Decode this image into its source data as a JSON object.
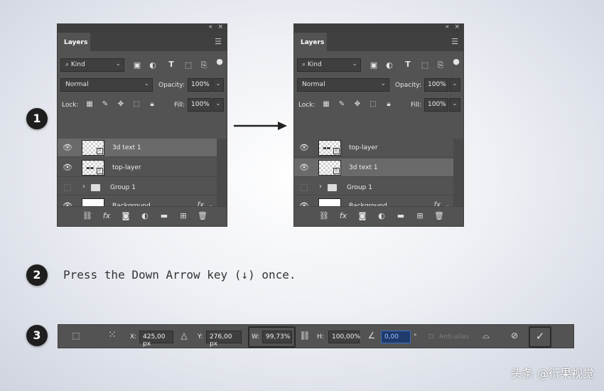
{
  "left_panel": {
    "tab": "Layers",
    "collapse_glyph": "«",
    "close_glyph": "×",
    "filter_kind": "Kind",
    "blend_mode": "Normal",
    "opacity_label": "Opacity:",
    "opacity_value": "100%",
    "lock_label": "Lock:",
    "fill_label": "Fill:",
    "fill_value": "100%",
    "layers": [
      {
        "name": "3d text 1",
        "type": "smart",
        "selected": true
      },
      {
        "name": "top-layer",
        "type": "smart",
        "selected": false
      },
      {
        "name": "Group 1",
        "type": "group",
        "selected": false
      },
      {
        "name": "Background",
        "type": "white",
        "selected": false
      }
    ],
    "fx_label": "fx"
  },
  "right_panel": {
    "tab": "Layers",
    "collapse_glyph": "«",
    "close_glyph": "×",
    "filter_kind": "Kind",
    "blend_mode": "Normal",
    "opacity_label": "Opacity:",
    "opacity_value": "100%",
    "lock_label": "Lock:",
    "fill_label": "Fill:",
    "fill_value": "100%",
    "layers": [
      {
        "name": "top-layer",
        "type": "smart",
        "selected": false
      },
      {
        "name": "3d text 1",
        "type": "smart",
        "selected": true
      },
      {
        "name": "Group 1",
        "type": "group",
        "selected": false
      },
      {
        "name": "Background",
        "type": "white",
        "selected": false
      }
    ],
    "fx_label": "fx"
  },
  "steps": [
    "1",
    "2",
    "3"
  ],
  "instruction": "Press the Down Arrow key (↓) once.",
  "options_bar": {
    "x_label": "X:",
    "x_value": "425,00 px",
    "y_label": "Y:",
    "y_value": "276,00 px",
    "w_label": "W:",
    "w_value": "99,73%",
    "h_label": "H:",
    "h_value": "100,00%",
    "angle_value": "0,00",
    "degree": "°",
    "antialias_label": "Anti-alias"
  },
  "watermark": "头条 @衍果视觉"
}
